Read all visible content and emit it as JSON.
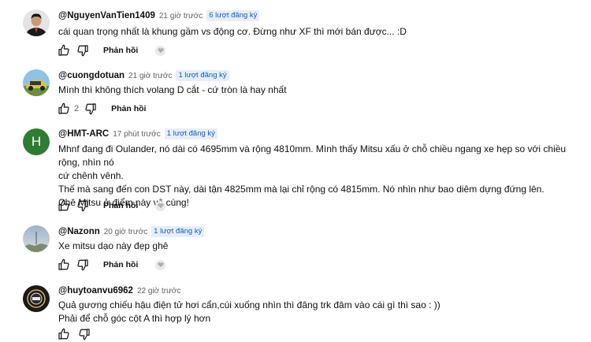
{
  "comments": [
    {
      "handle": "@NguyenVanTien1409",
      "time": "21 giờ trước",
      "badge": "6 lượt đăng ký",
      "avatar": "person-photo",
      "lines": [
        "cái quan trọng nhất là khung gầm vs động cơ. Đừng như XF thì mới bán được... :D"
      ],
      "likes": "",
      "reply_label": "Phản hồi"
    },
    {
      "handle": "@cuongdotuan",
      "time": "21 giờ trước",
      "badge": "1 lượt đăng ký",
      "avatar": "car-photo",
      "lines": [
        "Mình thì không thích volang D cắt - cứ tròn là hay nhất"
      ],
      "likes": "2",
      "reply_label": "Phản hồi"
    },
    {
      "handle": "@HMT-ARC",
      "time": "17 phút trước",
      "badge": "1 lượt đăng ký",
      "avatar_letter": "H",
      "avatar_color": "#2e7d32",
      "lines": [
        "Mhnf đang đi Oulander, nó dài có 4695mm và rộng 4810mm. Mình thấy Mitsu xấu ở chỗ chiều ngang xe hẹp so với chiều rộng, nhìn nó",
        "cứ chênh vênh.",
        "Thế mà sang đến con DST này, dài tận 4825mm mà lại chỉ rộng có 4815mm. Nó nhìn như bao diêm dựng đứng lên.",
        "Chê Mitsu ở điểm này vô cùng!"
      ],
      "likes": "",
      "reply_label": "Phản hồi"
    },
    {
      "handle": "@Nazonn",
      "time": "20 giờ trước",
      "badge": "1 lượt đăng ký",
      "avatar": "sky-photo",
      "lines": [
        "Xe mitsu dạo này đẹp ghê"
      ],
      "likes": "",
      "reply_label": "Phản hồi"
    },
    {
      "handle": "@huytoanvu6962",
      "time": "22 giờ trước",
      "badge": "",
      "avatar": "logo-photo",
      "lines": [
        "Quả gương chiếu hậu điện tử hơi cẩn,cúi xuống nhìn thì đâng trk đâm vào cái gì thì sao : ))",
        "Phải để chỗ góc cột A thì hợp lý hơn"
      ],
      "likes": "",
      "reply_label": ""
    }
  ],
  "icons": {
    "like": "thumbs-up-icon",
    "dislike": "thumbs-down-icon",
    "heart": "creator-heart-icon"
  },
  "colors": {
    "badge_text": "#065fd4",
    "badge_bg": "#e8eef9",
    "meta_text": "#606060"
  }
}
